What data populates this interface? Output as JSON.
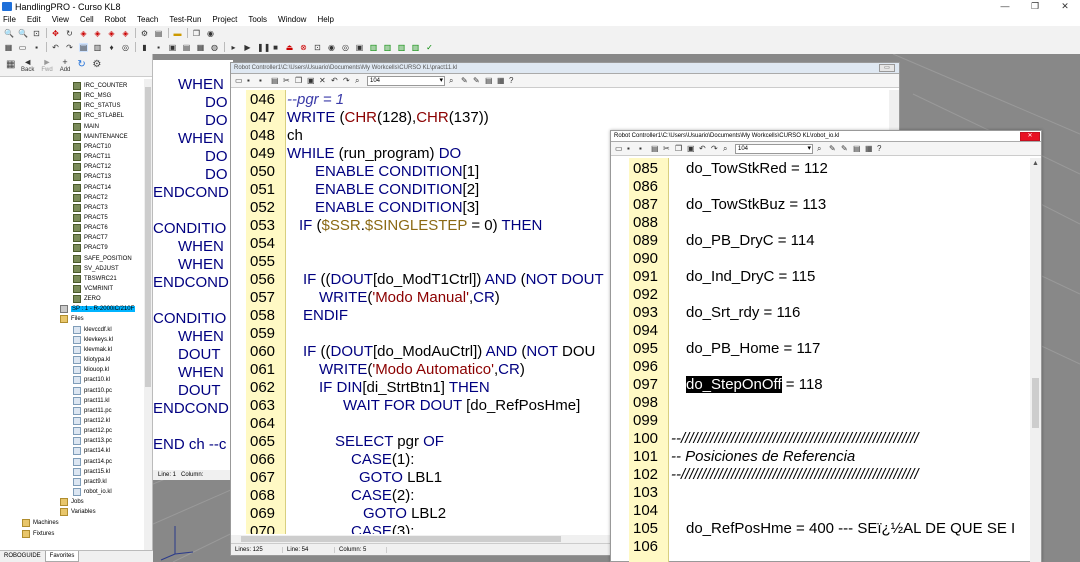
{
  "app": {
    "title": "HandlingPRO - Curso KL8",
    "window_controls": [
      "—",
      "❐",
      "✕"
    ]
  },
  "menu": [
    "File",
    "Edit",
    "View",
    "Cell",
    "Robot",
    "Teach",
    "Test-Run",
    "Project",
    "Tools",
    "Window",
    "Help"
  ],
  "nav": {
    "back_label": "Back",
    "fwd_label": "Fwd",
    "add_label": "Add"
  },
  "tree": {
    "programs": [
      "IRC_COUNTER",
      "IRC_MSG",
      "IRC_STATUS",
      "IRC_STLABEL",
      "MAIN",
      "MAINTENANCE",
      "PRACT10",
      "PRACT11",
      "PRACT12",
      "PRACT13",
      "PRACT14",
      "PRACT2",
      "PRACT3",
      "PRACT5",
      "PRACT6",
      "PRACT7",
      "PRACT9",
      "SAFE_POSITION",
      "SV_ADJUST",
      "TBSWRC21",
      "VCMRINIT",
      "ZERO"
    ],
    "selected_item": "SP : 1 - R-2000iC/210F",
    "files_label": "Files",
    "files": [
      "klevccdf.kl",
      "klevkeys.kl",
      "klevmak.kl",
      "kliotypa.kl",
      "kliouop.kl",
      "pract10.kl",
      "pract10.pc",
      "pract11.kl",
      "pract11.pc",
      "pract12.kl",
      "pract12.pc",
      "pract13.pc",
      "pract14.kl",
      "pract14.pc",
      "pract15.kl",
      "pract9.kl",
      "robot_io.kl"
    ],
    "jobs_label": "Jobs",
    "variables_label": "Variables",
    "machines_label": "Machines",
    "fixtures_label": "Fixtures"
  },
  "left_tabs": [
    "ROBOGUIDE",
    "Favorites"
  ],
  "back_editor": {
    "lines": [
      "WHEN",
      "DO",
      "DO",
      "WHEN",
      "DO",
      "DO",
      "ENDCOND",
      "",
      "CONDITIO",
      "WHEN",
      "WHEN",
      "ENDCOND",
      "",
      "CONDITIO",
      "WHEN",
      "DOUT",
      "WHEN",
      "DOUT",
      "ENDCOND",
      "",
      "END ch --c"
    ],
    "status": [
      "Line: 1",
      "Column:"
    ]
  },
  "editor": {
    "title": "Robot Controller1\\C:\\Users\\Usuario\\Documents\\My Workcells\\CURSO KL\\pract11.kl",
    "search_value": "104",
    "status": {
      "lines": "Lines: 125",
      "line": "Line: 54",
      "column": "Column: 5"
    },
    "lines": [
      {
        "n": "046",
        "t": "--pgr = 1"
      },
      {
        "n": "047",
        "t": "WRITE (CHR(128),CHR(137))"
      },
      {
        "n": "048",
        "t": "ch"
      },
      {
        "n": "049",
        "t": "WHILE (run_program) DO"
      },
      {
        "n": "050",
        "t": "ENABLE CONDITION[1]"
      },
      {
        "n": "051",
        "t": "ENABLE CONDITION[2]"
      },
      {
        "n": "052",
        "t": "ENABLE CONDITION[3]"
      },
      {
        "n": "053",
        "t": "IF ($SSR.$SINGLESTEP = 0) THEN"
      },
      {
        "n": "054",
        "t": ""
      },
      {
        "n": "055",
        "t": ""
      },
      {
        "n": "056",
        "t": "IF ((DOUT[do_ModT1Ctrl]) AND (NOT DOUT"
      },
      {
        "n": "057",
        "t": "WRITE('Modo Manual',CR)"
      },
      {
        "n": "058",
        "t": "ENDIF"
      },
      {
        "n": "059",
        "t": ""
      },
      {
        "n": "060",
        "t": "IF ((DOUT[do_ModAuCtrl]) AND (NOT DOU"
      },
      {
        "n": "061",
        "t": "WRITE('Modo Automatico',CR)"
      },
      {
        "n": "062",
        "t": "IF DIN[di_StrtBtn1] THEN"
      },
      {
        "n": "063",
        "t": "WAIT FOR DOUT [do_RefPosHme]"
      },
      {
        "n": "064",
        "t": ""
      },
      {
        "n": "065",
        "t": "SELECT pgr OF"
      },
      {
        "n": "066",
        "t": "CASE(1):"
      },
      {
        "n": "067",
        "t": "GOTO LBL1"
      },
      {
        "n": "068",
        "t": "CASE(2):"
      },
      {
        "n": "069",
        "t": "GOTO LBL2"
      },
      {
        "n": "070",
        "t": "CASE(3):"
      }
    ]
  },
  "io_editor": {
    "title": "Robot Controller1\\C:\\Users\\Usuario\\Documents\\My Workcells\\CURSO KL\\robot_io.kl",
    "search_value": "104",
    "lines": [
      {
        "n": "085",
        "t": "do_TowStkRed = 112"
      },
      {
        "n": "086",
        "t": ""
      },
      {
        "n": "087",
        "t": "do_TowStkBuz = 113"
      },
      {
        "n": "088",
        "t": ""
      },
      {
        "n": "089",
        "t": "do_PB_DryC = 114"
      },
      {
        "n": "090",
        "t": ""
      },
      {
        "n": "091",
        "t": "do_Ind_DryC = 115"
      },
      {
        "n": "092",
        "t": ""
      },
      {
        "n": "093",
        "t": "do_Srt_rdy = 116"
      },
      {
        "n": "094",
        "t": ""
      },
      {
        "n": "095",
        "t": "do_PB_Home = 117"
      },
      {
        "n": "096",
        "t": ""
      },
      {
        "n": "097",
        "t": "do_StepOnOff = 118"
      },
      {
        "n": "098",
        "t": ""
      },
      {
        "n": "099",
        "t": ""
      },
      {
        "n": "100",
        "t": "--/////////////////////////////////////////////////////////"
      },
      {
        "n": "101",
        "t": "--                        Posiciones de Referencia"
      },
      {
        "n": "102",
        "t": "--/////////////////////////////////////////////////////////"
      },
      {
        "n": "103",
        "t": ""
      },
      {
        "n": "104",
        "t": ""
      },
      {
        "n": "105",
        "t": "do_RefPosHme = 400 --- SEï¿½AL DE QUE SE I"
      },
      {
        "n": "106",
        "t": ""
      }
    ],
    "selected_text": "do_StepOnOff"
  }
}
